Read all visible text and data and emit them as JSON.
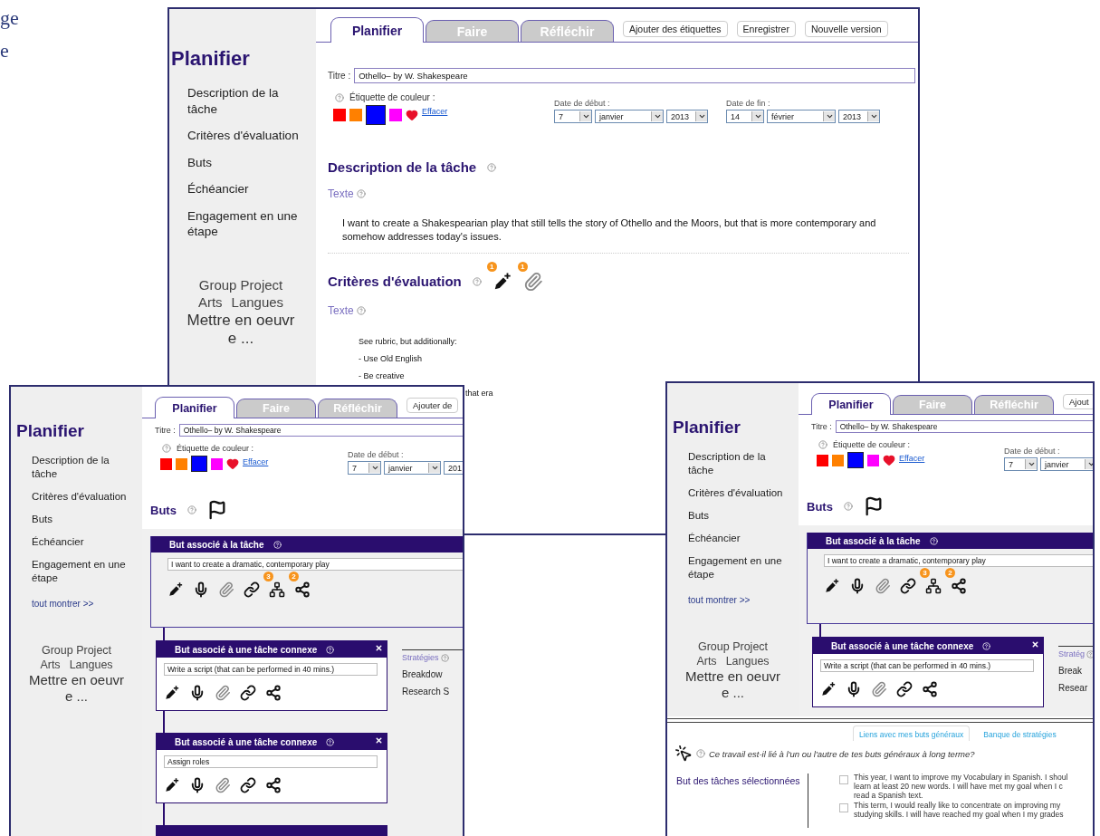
{
  "edge_text": [
    "ge",
    "e"
  ],
  "windows": [
    {
      "sidebar": {
        "title": "Planifier",
        "items": [
          "Description de la tâche",
          "Critères d'évaluation",
          "Buts",
          "Échéancier",
          "Engagement en une étape"
        ],
        "footer": {
          "project": "Group Project",
          "subjects": [
            "Arts",
            "Langues"
          ],
          "status_lines": [
            "Mettre en oeuvr",
            "e ..."
          ]
        }
      },
      "tabs": [
        {
          "label": "Planifier",
          "selected": true
        },
        {
          "label": "Faire",
          "selected": false
        },
        {
          "label": "Réfléchir",
          "selected": false
        }
      ],
      "buttons": [
        "Ajouter des étiquettes",
        "Enregistrer",
        "Nouvelle version"
      ],
      "title_field": {
        "label": "Titre :",
        "value": "Othello– by W. Shakespeare"
      },
      "color_tag": {
        "label": "Étiquette de couleur :",
        "swatches": [
          {
            "color": "#ff0000",
            "selected": false
          },
          {
            "color": "#ff8000",
            "selected": false
          },
          {
            "color": "#0000ff",
            "selected": true
          },
          {
            "color": "#ff00ff",
            "selected": false
          }
        ],
        "clear_link": "Effacer"
      },
      "dates": [
        {
          "label": "Date de début :",
          "day": "7",
          "month": "janvier",
          "year": "2013"
        },
        {
          "label": "Date de fin :",
          "day": "14",
          "month": "février",
          "year": "2013"
        }
      ],
      "sections": [
        {
          "kind": "text",
          "heading": "Description de la tâche",
          "subheading": "Texte",
          "paragraph": "I want to create a Shakespearian play that still tells the story of Othello and the Moors, but that is more contemporary and somehow addresses today's issues."
        },
        {
          "kind": "list",
          "heading": "Critères d'évaluation",
          "tools": [
            {
              "kind": "pencil-plus",
              "badge": "1"
            },
            {
              "kind": "clip",
              "badge": "1"
            }
          ],
          "subheading": "Texte",
          "lines": [
            "See rubric, but additionally:",
            "- Use Old English",
            "- Be creative"
          ],
          "tail": "that era"
        }
      ]
    },
    {
      "sidebar": {
        "title": "Planifier",
        "items": [
          "Description de la tâche",
          "Critères d'évaluation",
          "Buts",
          "Échéancier",
          "Engagement en une étape"
        ],
        "show_all": "tout montrer >>",
        "footer": {
          "project": "Group Project",
          "subjects": [
            "Arts",
            "Langues"
          ],
          "status_lines": [
            "Mettre en oeuvr",
            "e ..."
          ]
        }
      },
      "tabs": [
        {
          "label": "Planifier",
          "selected": true
        },
        {
          "label": "Faire",
          "selected": false
        },
        {
          "label": "Réfléchir",
          "selected": false
        }
      ],
      "buttons": [
        "Ajouter de"
      ],
      "title_field": {
        "label": "Titre :",
        "value": "Othello– by W. Shakespeare"
      },
      "color_tag": {
        "label": "Étiquette de couleur :",
        "swatches": [
          {
            "color": "#ff0000",
            "selected": false
          },
          {
            "color": "#ff8000",
            "selected": false
          },
          {
            "color": "#0000ff",
            "selected": true
          },
          {
            "color": "#ff00ff",
            "selected": false
          }
        ],
        "clear_link": "Effacer"
      },
      "dates": [
        {
          "label": "Date de début :",
          "day": "7",
          "month": "janvier",
          "year": "201"
        }
      ],
      "sections": [
        {
          "kind": "goals",
          "heading": "Buts",
          "main_goal": {
            "title": "But associé à la tâche",
            "value": "I want to create a dramatic, contemporary play",
            "tools": [
              {
                "kind": "pencil-plus"
              },
              {
                "kind": "mic"
              },
              {
                "kind": "clip"
              },
              {
                "kind": "link"
              },
              {
                "kind": "tree",
                "badge": "3"
              },
              {
                "kind": "share",
                "badge": "2"
              }
            ]
          },
          "sub_goals": [
            {
              "title": "But associé à une tâche connexe",
              "value": "Write a script (that can be performed in 40 mins.)",
              "tools": [
                {
                  "kind": "pencil-plus"
                },
                {
                  "kind": "mic"
                },
                {
                  "kind": "clip"
                },
                {
                  "kind": "link"
                },
                {
                  "kind": "share"
                }
              ]
            },
            {
              "title": "But associé à une tâche connexe",
              "value": "Assign roles",
              "tools": [
                {
                  "kind": "pencil-plus"
                },
                {
                  "kind": "mic"
                },
                {
                  "kind": "clip"
                },
                {
                  "kind": "link"
                },
                {
                  "kind": "share"
                }
              ]
            }
          ],
          "more_below": true,
          "strategies": {
            "heading": "Stratégies",
            "items": [
              "Breakdow",
              "Research S"
            ]
          }
        }
      ]
    },
    {
      "sidebar": {
        "title": "Planifier",
        "items": [
          "Description de la tâche",
          "Critères d'évaluation",
          "Buts",
          "Échéancier",
          "Engagement en une étape"
        ],
        "show_all": "tout montrer >>",
        "footer": {
          "project": "Group Project",
          "subjects": [
            "Arts",
            "Langues"
          ],
          "status_lines": [
            "Mettre en oeuvr",
            "e ..."
          ]
        }
      },
      "tabs": [
        {
          "label": "Planifier",
          "selected": true
        },
        {
          "label": "Faire",
          "selected": false
        },
        {
          "label": "Réfléchir",
          "selected": false
        }
      ],
      "buttons": [
        "Ajout"
      ],
      "title_field": {
        "label": "Titre :",
        "value": "Othello– by W. Shakespeare"
      },
      "color_tag": {
        "label": "Étiquette de couleur :",
        "swatches": [
          {
            "color": "#ff0000",
            "selected": false
          },
          {
            "color": "#ff8000",
            "selected": false
          },
          {
            "color": "#0000ff",
            "selected": true
          },
          {
            "color": "#ff00ff",
            "selected": false
          }
        ],
        "clear_link": "Effacer"
      },
      "dates": [
        {
          "label": "Date de début :",
          "day": "7",
          "month": "janvier"
        }
      ],
      "sections": [
        {
          "kind": "goals",
          "heading": "Buts",
          "main_goal": {
            "title": "But associé à la tâche",
            "value": "I want to create a dramatic, contemporary play",
            "tools": [
              {
                "kind": "pencil-plus"
              },
              {
                "kind": "mic"
              },
              {
                "kind": "clip"
              },
              {
                "kind": "link"
              },
              {
                "kind": "tree",
                "badge": "3"
              },
              {
                "kind": "share",
                "badge": "2"
              }
            ]
          },
          "sub_goals": [
            {
              "title": "But associé à une tâche connexe",
              "value": "Write a script (that can be performed in 40 mins.)",
              "tools": [
                {
                  "kind": "pencil-plus"
                },
                {
                  "kind": "mic"
                },
                {
                  "kind": "clip"
                },
                {
                  "kind": "link"
                },
                {
                  "kind": "share"
                }
              ]
            }
          ],
          "strategies": {
            "heading": "Stratég",
            "items": [
              "Break",
              "Resear"
            ]
          }
        }
      ],
      "bottom_panel": {
        "tabs": [
          {
            "label": "Liens avec mes buts généraux",
            "selected": true
          },
          {
            "label": "Banque de stratégies",
            "selected": false
          }
        ],
        "question": "Ce travail est-il lié à l'un ou l'autre de tes buts généraux à long terme?",
        "label": "But des tâches sélectionnées",
        "options": [
          {
            "lines": [
              "This year, I want to improve my Vocabulary in Spanish. I shoul",
              "learn at least 20 new words. I will have met my goal when I c",
              "read a Spanish text."
            ],
            "checked": false
          },
          {
            "lines": [
              "This term, I would really like to concentrate on improving my",
              "studying skills. I will have reached my goal when I my grades"
            ],
            "checked": false
          }
        ]
      }
    }
  ]
}
